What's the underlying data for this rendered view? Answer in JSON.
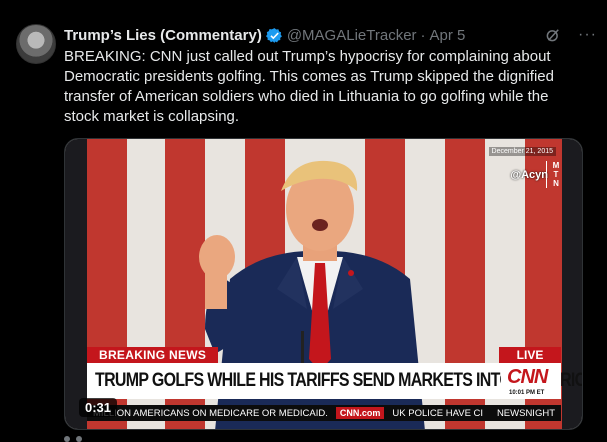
{
  "tweet": {
    "author_name": "Trump’s Lies (Commentary)",
    "handle": "@MAGALieTracker",
    "separator": "·",
    "date": "Apr 5",
    "more_label": "···",
    "text": "BREAKING: CNN just called out Trump’s hypocrisy for complaining about Democratic presidents golfing. This comes as Trump skipped the dignified transfer of American soldiers who died in Lithuania to go golfing while the stock market is collapsing."
  },
  "video": {
    "overlay_date": "December 21, 2015",
    "watermark": "@Acyn",
    "mtn_letters": "M T N",
    "breaking_label": "BREAKING NEWS",
    "live_label": "LIVE",
    "headline": "TRUMP GOLFS WHILE HIS TARIFFS SEND MARKETS INTO HISTORIC DIVE",
    "network_logo": "CNN",
    "network_time": "10:01 PM ET",
    "ticker_left": "MILLION AMERICANS ON MEDICARE OR MEDICAID.",
    "ticker_site": "CNN.com",
    "ticker_right": "UK POLICE HAVE CI",
    "ticker_show": "NEWSNIGHT",
    "timestamp": "0:31"
  },
  "colors": {
    "verified_badge": "#1d9bf0",
    "cnn_red": "#c4161c",
    "background": "#000000"
  }
}
